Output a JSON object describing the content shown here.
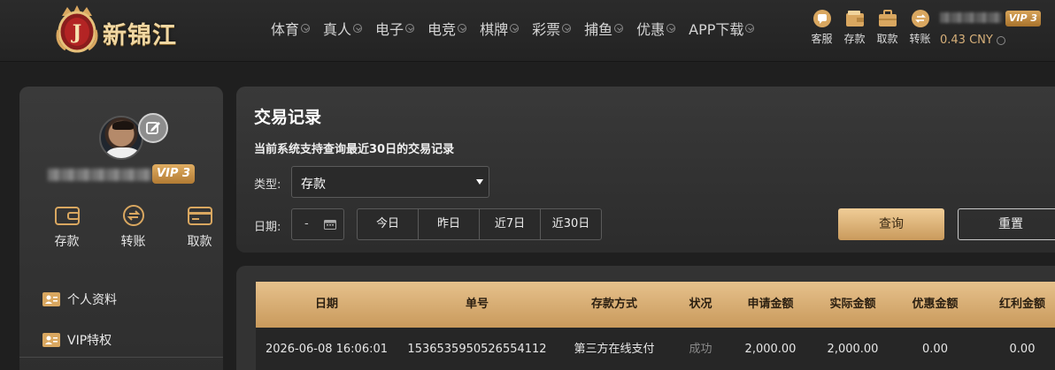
{
  "brand": {
    "name": "新锦江",
    "emblem_letter": "J"
  },
  "nav": {
    "items": [
      {
        "label": "体育"
      },
      {
        "label": "真人"
      },
      {
        "label": "电子"
      },
      {
        "label": "电竞"
      },
      {
        "label": "棋牌"
      },
      {
        "label": "彩票"
      },
      {
        "label": "捕鱼"
      },
      {
        "label": "优惠"
      },
      {
        "label": "APP下载"
      }
    ]
  },
  "quick": {
    "service": "客服",
    "deposit": "存款",
    "withdraw": "取款",
    "transfer": "转账"
  },
  "user": {
    "vip": "VIP 3",
    "balance": "0.43 CNY"
  },
  "sidebar": {
    "vip": "VIP 3",
    "actions": {
      "deposit": "存款",
      "transfer": "转账",
      "withdraw": "取款"
    },
    "menu": [
      {
        "label": "个人资料"
      },
      {
        "label": "VIP特权"
      }
    ]
  },
  "filters": {
    "title": "交易记录",
    "note": "当前系统支持查询最近30日的交易记录",
    "type_label": "类型:",
    "type_value": "存款",
    "date_label": "日期:",
    "date_value": "-",
    "ranges": [
      {
        "label": "今日"
      },
      {
        "label": "昨日"
      },
      {
        "label": "近7日"
      },
      {
        "label": "近30日"
      }
    ],
    "query": "查询",
    "reset": "重置"
  },
  "table": {
    "columns": [
      "日期",
      "单号",
      "存款方式",
      "状况",
      "申请金额",
      "实际金额",
      "优惠金额",
      "红利金额"
    ],
    "rows": [
      [
        "2026-06-08 16:06:01",
        "1536535950526554112",
        "第三方在线支付",
        "成功",
        "2,000.00",
        "2,000.00",
        "0.00",
        "0.00"
      ]
    ]
  },
  "colors": {
    "accent": "#d9a760",
    "header_bg": "#2b2b2b",
    "panel_bg": "#333333",
    "status_success": "#8a8a8a"
  }
}
